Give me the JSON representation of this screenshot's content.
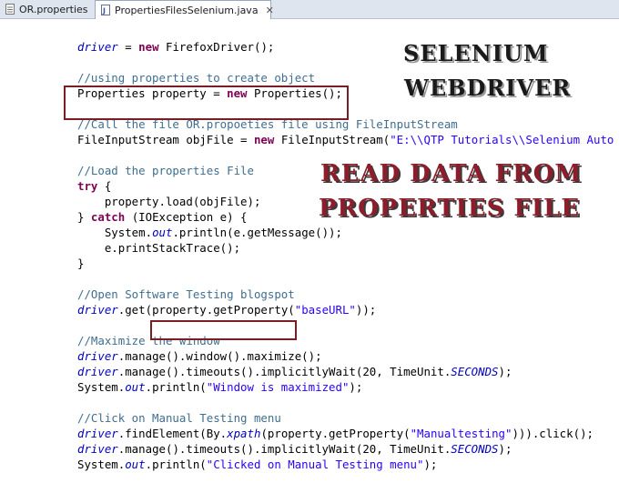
{
  "tabs": [
    {
      "label": "OR.properties",
      "icon": "properties-file-icon",
      "active": false
    },
    {
      "label": "PropertiesFilesSelenium.java",
      "icon": "java-file-icon",
      "active": true,
      "close": "✕"
    }
  ],
  "overlay": {
    "line1": "SELENIUM",
    "line2": "WEBDRIVER",
    "line3": "READ DATA FROM",
    "line4": "PROPERTIES FILE",
    "colors": {
      "dark": "#1a1a1a",
      "accent": "#8b1e2a"
    }
  },
  "code": {
    "l1": [
      "driver",
      " = ",
      "new",
      " FirefoxDriver();"
    ],
    "l3": "//using properties to create object",
    "l4": [
      "Properties property = ",
      "new",
      " Properties();"
    ],
    "l6": "//Call the file OR.propoeties file using FileInputStream",
    "l7": [
      "FileInputStream objFile = ",
      "new",
      " FileInputStream(",
      "\"E:\\\\QTP Tutorials\\\\Selenium Auto"
    ],
    "l9": "//Load the properties File",
    "l10": "try",
    "l10b": " {",
    "l11": "    property.load(objFile);",
    "l12": [
      "} ",
      "catch",
      " (IOException e) {"
    ],
    "l13": [
      "    System.",
      "out",
      ".println(e.getMessage());"
    ],
    "l14": "    e.printStackTrace();",
    "l15": "}",
    "l17": "//Open Software Testing blogspot",
    "l18": [
      "driver",
      ".get(",
      "property.getProperty(",
      "\"baseURL\"",
      "));"
    ],
    "l20": "//Maximize the window",
    "l21": [
      "driver",
      ".manage().window().maximize();"
    ],
    "l22": [
      "driver",
      ".manage().timeouts().implicitlyWait(20, TimeUnit.",
      "SECONDS",
      ");"
    ],
    "l23": [
      "System.",
      "out",
      ".println(",
      "\"Window is maximized\"",
      ");"
    ],
    "l25": "//Click on Manual Testing menu",
    "l26": [
      "driver",
      ".findElement(By.",
      "xpath",
      "(property.getProperty(",
      "\"Manualtesting\"",
      "))).click();"
    ],
    "l27": [
      "driver",
      ".manage().timeouts().implicitlyWait(20, TimeUnit.",
      "SECONDS",
      ");"
    ],
    "l28": [
      "System.",
      "out",
      ".println(",
      "\"Clicked on Manual Testing menu\"",
      ");"
    ]
  }
}
